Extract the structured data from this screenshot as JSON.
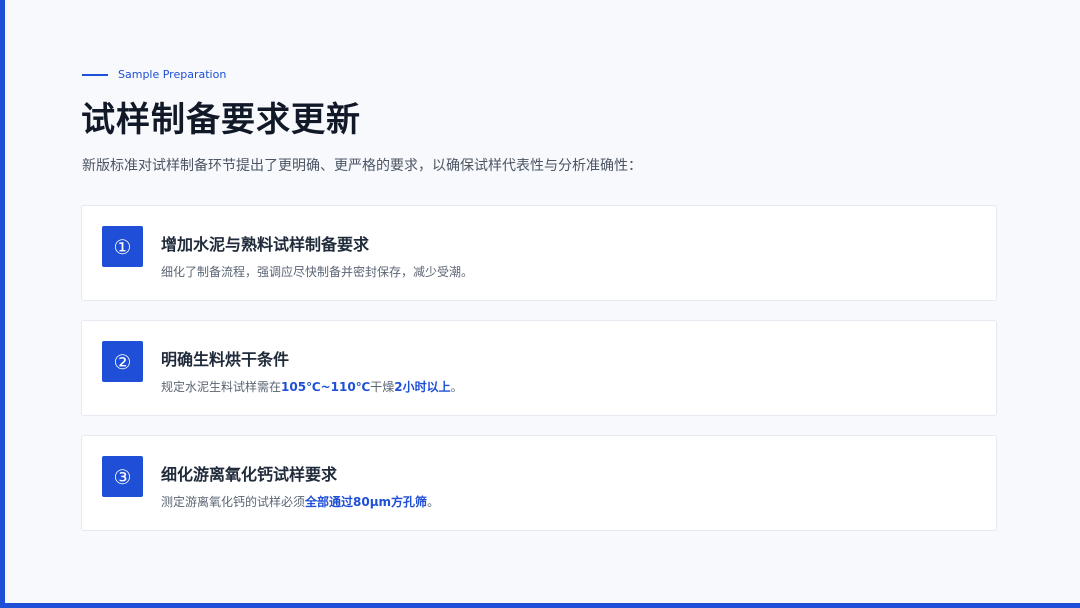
{
  "header": {
    "eyebrow": "Sample Preparation",
    "title": "试样制备要求更新",
    "subtitle": "新版标准对试样制备环节提出了更明确、更严格的要求，以确保试样代表性与分析准确性："
  },
  "items": [
    {
      "badge": "①",
      "title": "增加水泥与熟料试样制备要求",
      "desc": "细化了制备流程，强调应尽快制备并密封保存，减少受潮。"
    },
    {
      "badge": "②",
      "title": "明确生料烘干条件",
      "desc_pre": "规定水泥生料试样需在",
      "desc_hl1": "105℃~110℃",
      "desc_mid": "干燥",
      "desc_hl2": "2小时以上",
      "desc_post": "。"
    },
    {
      "badge": "③",
      "title": "细化游离氧化钙试样要求",
      "desc_pre": "测定游离氧化钙的试样必须",
      "desc_hl": "全部通过80μm方孔筛",
      "desc_post": "。"
    }
  ],
  "colors": {
    "accent": "#1f4fd6",
    "background": "#f7f9fc",
    "card": "#ffffff"
  }
}
